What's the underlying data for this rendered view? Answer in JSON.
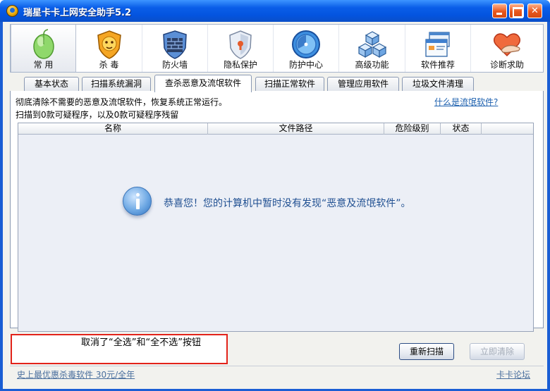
{
  "window": {
    "title": "瑞星卡卡上网安全助手5.2",
    "controls": [
      "minimize",
      "maximize",
      "close"
    ]
  },
  "toolbar": {
    "items": [
      {
        "label": "常 用",
        "icon": "mouse-icon",
        "active": true
      },
      {
        "label": "杀 毒",
        "icon": "lion-shield-icon"
      },
      {
        "label": "防火墙",
        "icon": "firewall-shield-icon"
      },
      {
        "label": "隐私保护",
        "icon": "privacy-shield-icon"
      },
      {
        "label": "防护中心",
        "icon": "protection-globe-icon"
      },
      {
        "label": "高级功能",
        "icon": "cubes-icon"
      },
      {
        "label": "软件推荐",
        "icon": "window-stack-icon"
      },
      {
        "label": "诊断求助",
        "icon": "heart-hand-icon"
      }
    ]
  },
  "tabs": [
    {
      "label": "基本状态"
    },
    {
      "label": "扫描系统漏洞"
    },
    {
      "label": "查杀恶意及流氓软件",
      "active": true
    },
    {
      "label": "扫描正常软件"
    },
    {
      "label": "管理应用软件"
    },
    {
      "label": "垃圾文件清理"
    }
  ],
  "pane": {
    "description": "彻底清除不需要的恶意及流氓软件，恢复系统正常运行。",
    "scan_result": "扫描到0款可疑程序，以及0款可疑程序残留",
    "help_link": "什么是流氓软件?",
    "columns": [
      "名称",
      "文件路径",
      "危险级别",
      "状态"
    ],
    "empty_message": "恭喜您！您的计算机中暂时没有发现“恶意及流氓软件”。"
  },
  "annotation": {
    "text": "取消了“全选”和“全不选”按钮",
    "border_color": "#e2231a"
  },
  "buttons": {
    "rescan": "重新扫描",
    "clean_now": "立即清除"
  },
  "footer": {
    "promo": "史上最优惠杀毒软件 30元/全年",
    "forum": "卡卡论坛"
  },
  "colors": {
    "titlebar": "#0a5ee8",
    "link": "#1b5fae",
    "annotation": "#e2231a"
  }
}
